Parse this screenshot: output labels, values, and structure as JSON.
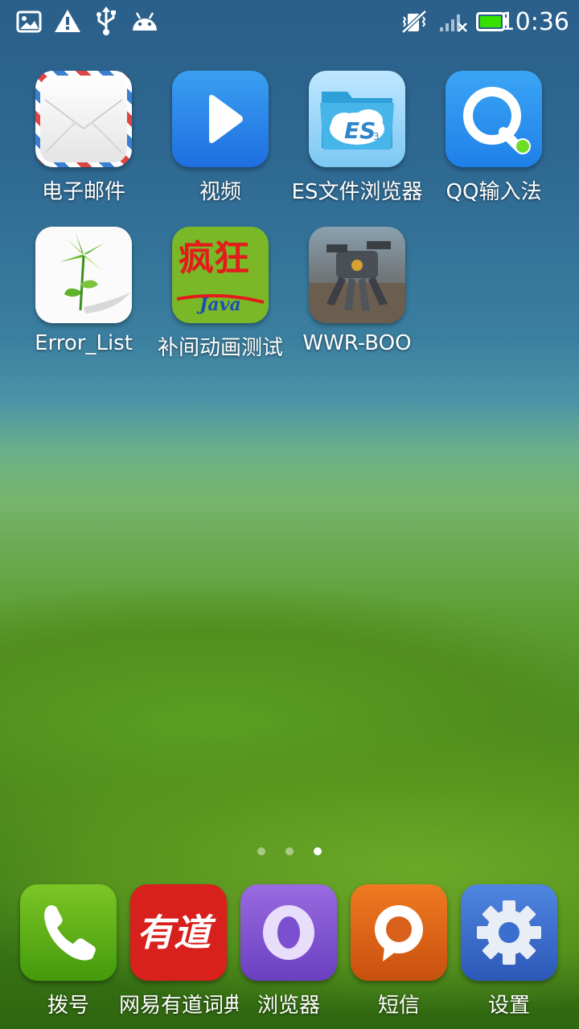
{
  "status_bar": {
    "left_icons": [
      "image-notification-icon",
      "warning-icon",
      "usb-icon",
      "android-debug-icon"
    ],
    "right_icons": [
      "vibrate-mute-icon",
      "signal-no-sim-icon",
      "battery-icon"
    ],
    "time": "10:36"
  },
  "home_apps": [
    {
      "label": "电子邮件",
      "icon": "email-icon"
    },
    {
      "label": "视频",
      "icon": "video-play-icon"
    },
    {
      "label": "ES文件浏览器",
      "icon": "es-file-explorer-icon"
    },
    {
      "label": "QQ输入法",
      "icon": "qq-input-icon"
    },
    {
      "label": "Error_List",
      "icon": "pinwheel-plant-icon"
    },
    {
      "label": "补间动画测试",
      "icon": "java-calligraphy-icon"
    },
    {
      "label": "WWR-BOO",
      "icon": "robot-game-icon"
    }
  ],
  "page_indicator": {
    "pages": 3,
    "current": 3
  },
  "dock_apps": [
    {
      "label": "拨号",
      "icon": "phone-icon"
    },
    {
      "label": "网易有道词典",
      "icon": "youdao-dictionary-icon"
    },
    {
      "label": "浏览器",
      "icon": "browser-icon"
    },
    {
      "label": "短信",
      "icon": "message-icon"
    },
    {
      "label": "设置",
      "icon": "settings-gear-icon"
    }
  ],
  "icon_texts": {
    "es_badge": "ES3",
    "java_chars": "疯狂",
    "java_word": "Java",
    "youdao": "有道"
  },
  "colors": {
    "battery": "#38e000",
    "qq_dot": "#6fdc2a",
    "youdao_red": "#d8201c",
    "browser_purple": "#7a4fd0",
    "sms_orange": "#e06a1c",
    "settings_blue": "#3a6fcf",
    "phone_green": "#5cb014"
  }
}
